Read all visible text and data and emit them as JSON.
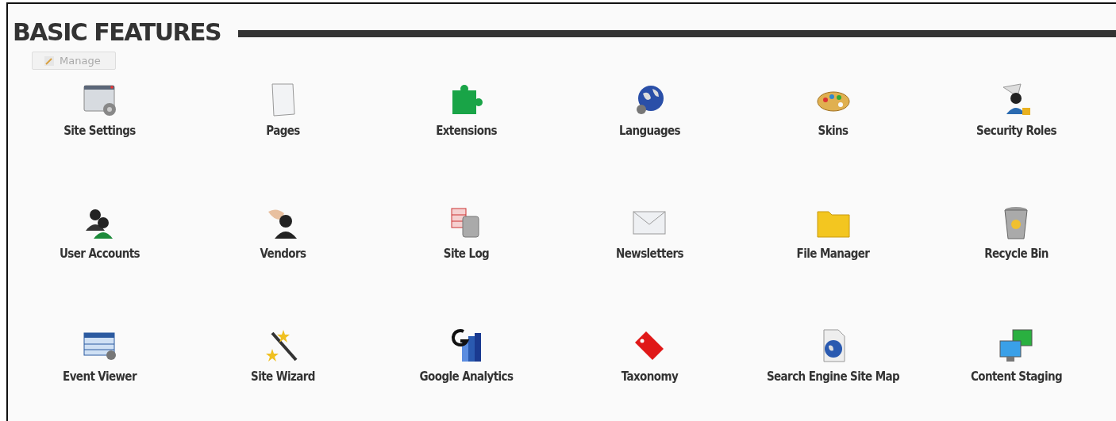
{
  "section": {
    "title": "BASIC FEATURES"
  },
  "manage_button": {
    "label": "Manage"
  },
  "features": [
    {
      "label": "Site Settings"
    },
    {
      "label": "Pages"
    },
    {
      "label": "Extensions"
    },
    {
      "label": "Languages"
    },
    {
      "label": "Skins"
    },
    {
      "label": "Security Roles"
    },
    {
      "label": "User Accounts"
    },
    {
      "label": "Vendors"
    },
    {
      "label": "Site Log"
    },
    {
      "label": "Newsletters"
    },
    {
      "label": "File Manager"
    },
    {
      "label": "Recycle Bin"
    },
    {
      "label": "Event Viewer"
    },
    {
      "label": "Site Wizard"
    },
    {
      "label": "Google Analytics"
    },
    {
      "label": "Taxonomy"
    },
    {
      "label": "Search Engine Site Map"
    },
    {
      "label": "Content Staging"
    }
  ]
}
